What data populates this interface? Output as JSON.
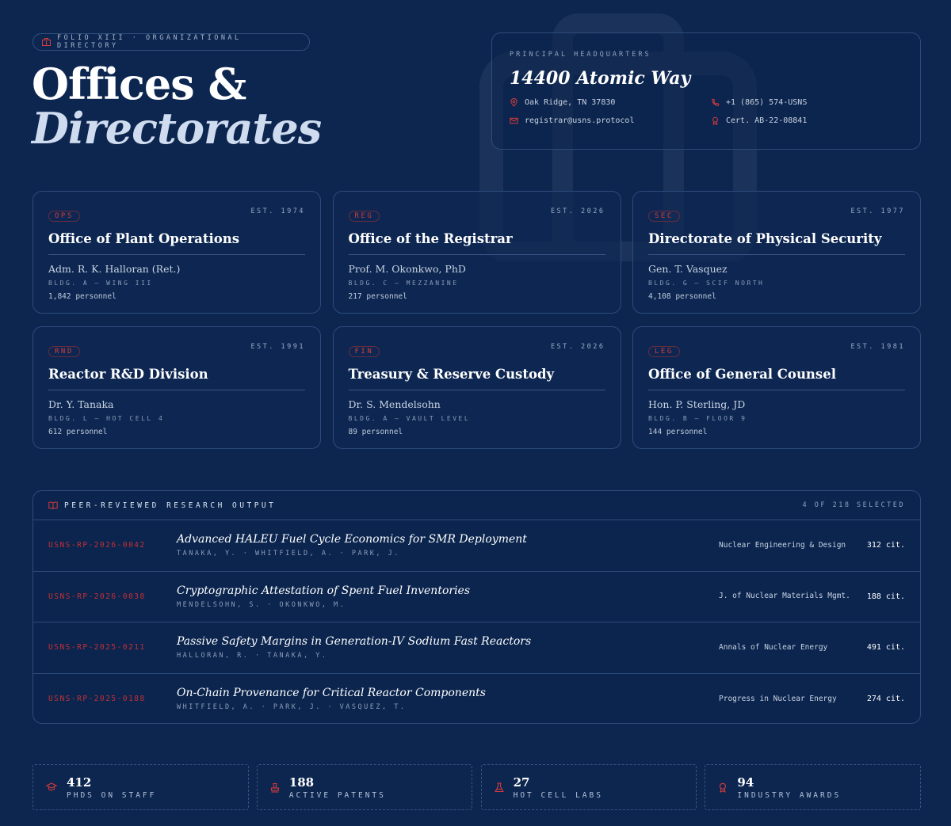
{
  "header": {
    "eyebrow": "FOLIO XIII · ORGANIZATIONAL DIRECTORY",
    "title_line1": "Offices &",
    "title_line2": "Directorates"
  },
  "hq": {
    "label": "PRINCIPAL HEADQUARTERS",
    "address": "14400 Atomic Way",
    "city": "Oak Ridge, TN 37830",
    "phone": "+1 (865) 574-USNS",
    "email": "registrar@usns.protocol",
    "cert": "Cert. AB-22-08841"
  },
  "offices": [
    {
      "code": "OPS",
      "est": "EST. 1974",
      "name": "Office of Plant Operations",
      "head": "Adm. R. K. Halloran (Ret.)",
      "bldg": "BLDG. A — WING III",
      "personnel": "1,842 personnel"
    },
    {
      "code": "REG",
      "est": "EST. 2026",
      "name": "Office of the Registrar",
      "head": "Prof. M. Okonkwo, PhD",
      "bldg": "BLDG. C — MEZZANINE",
      "personnel": "217 personnel"
    },
    {
      "code": "SEC",
      "est": "EST. 1977",
      "name": "Directorate of Physical Security",
      "head": "Gen. T. Vasquez",
      "bldg": "BLDG. G — SCIF NORTH",
      "personnel": "4,108 personnel"
    },
    {
      "code": "RND",
      "est": "EST. 1991",
      "name": "Reactor R&D Division",
      "head": "Dr. Y. Tanaka",
      "bldg": "BLDG. L — HOT CELL 4",
      "personnel": "612 personnel"
    },
    {
      "code": "FIN",
      "est": "EST. 2026",
      "name": "Treasury & Reserve Custody",
      "head": "Dr. S. Mendelsohn",
      "bldg": "BLDG. A — VAULT LEVEL",
      "personnel": "89 personnel"
    },
    {
      "code": "LEG",
      "est": "EST. 1981",
      "name": "Office of General Counsel",
      "head": "Hon. P. Sterling, JD",
      "bldg": "BLDG. B — FLOOR 9",
      "personnel": "144 personnel"
    }
  ],
  "research": {
    "title": "PEER-REVIEWED RESEARCH OUTPUT",
    "selected": "4 OF 218 SELECTED",
    "rows": [
      {
        "id": "USNS-RP-2026-0042",
        "title": "Advanced HALEU Fuel Cycle Economics for SMR Deployment",
        "authors": "TANAKA, Y. · WHITFIELD, A. · PARK, J.",
        "journal": "Nuclear Engineering & Design",
        "cit": "312 cit."
      },
      {
        "id": "USNS-RP-2026-0038",
        "title": "Cryptographic Attestation of Spent Fuel Inventories",
        "authors": "MENDELSOHN, S. · OKONKWO, M.",
        "journal": "J. of Nuclear Materials Mgmt.",
        "cit": "188 cit."
      },
      {
        "id": "USNS-RP-2025-0211",
        "title": "Passive Safety Margins in Generation-IV Sodium Fast Reactors",
        "authors": "HALLORAN, R. · TANAKA, Y.",
        "journal": "Annals of Nuclear Energy",
        "cit": "491 cit."
      },
      {
        "id": "USNS-RP-2025-0188",
        "title": "On-Chain Provenance for Critical Reactor Components",
        "authors": "WHITFIELD, A. · PARK, J. · VASQUEZ, T.",
        "journal": "Progress in Nuclear Energy",
        "cit": "274 cit."
      }
    ]
  },
  "stats": [
    {
      "num": "412",
      "label": "PHDS ON STAFF",
      "icon": "graduation-cap-icon"
    },
    {
      "num": "188",
      "label": "ACTIVE PATENTS",
      "icon": "stamp-icon"
    },
    {
      "num": "27",
      "label": "HOT CELL LABS",
      "icon": "flask-icon"
    },
    {
      "num": "94",
      "label": "INDUSTRY AWARDS",
      "icon": "award-icon"
    }
  ],
  "colors": {
    "background": "#0c2650",
    "accent": "#d63a3a",
    "border": "#2d4b7a"
  }
}
